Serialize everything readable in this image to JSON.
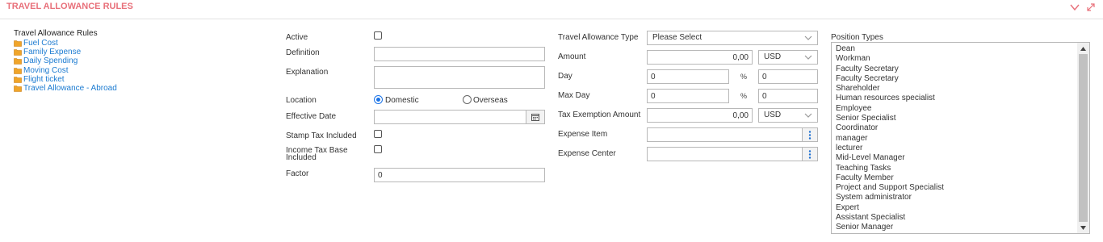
{
  "header": {
    "title": "TRAVEL ALLOWANCE RULES",
    "accent_color": "#e8707a"
  },
  "tree": {
    "title": "Travel Allowance Rules",
    "items": [
      {
        "label": "Fuel Cost",
        "icon": "folder-icon"
      },
      {
        "label": "Family Expense",
        "icon": "folder-icon"
      },
      {
        "label": "Daily Spending",
        "icon": "folder-icon"
      },
      {
        "label": "Moving Cost",
        "icon": "folder-icon"
      },
      {
        "label": "Flight ticket",
        "icon": "folder-icon"
      },
      {
        "label": "Travel Allowance - Abroad",
        "icon": "folder-icon"
      }
    ]
  },
  "form_left": {
    "active_label": "Active",
    "definition_label": "Definition",
    "definition_value": "",
    "explanation_label": "Explanation",
    "explanation_value": "",
    "location_label": "Location",
    "location_domestic": "Domestic",
    "location_overseas": "Overseas",
    "location_selected": "Domestic",
    "effective_date_label": "Effective Date",
    "effective_date_value": "",
    "stamp_tax_label": "Stamp Tax Included",
    "income_tax_label": "Income Tax Base Included",
    "factor_label": "Factor",
    "factor_value": "0"
  },
  "form_right": {
    "type_label": "Travel Allowance Type",
    "type_value": "Please Select",
    "amount_label": "Amount",
    "amount_value": "0,00",
    "amount_currency": "USD",
    "day_label": "Day",
    "day_value": "0",
    "day_pct_value": "0",
    "max_day_label": "Max Day",
    "max_day_value": "0",
    "max_day_pct_value": "0",
    "pct_symbol": "%",
    "tax_exemption_label": "Tax Exemption Amount",
    "tax_exemption_value": "0,00",
    "tax_exemption_currency": "USD",
    "expense_item_label": "Expense Item",
    "expense_item_value": "",
    "expense_center_label": "Expense Center",
    "expense_center_value": ""
  },
  "position_types": {
    "label": "Position Types",
    "options": [
      "Dean",
      "Workman",
      "Faculty Secretary",
      "Faculty Secretary",
      "Shareholder",
      "Human resources specialist",
      "Employee",
      "Senior Specialist",
      "Coordinator",
      "manager",
      "lecturer",
      "Mid-Level Manager",
      "Teaching Tasks",
      "Faculty Member",
      "Project and Support Specialist",
      "System administrator",
      "Expert",
      "Assistant Specialist",
      "Senior Manager"
    ]
  }
}
